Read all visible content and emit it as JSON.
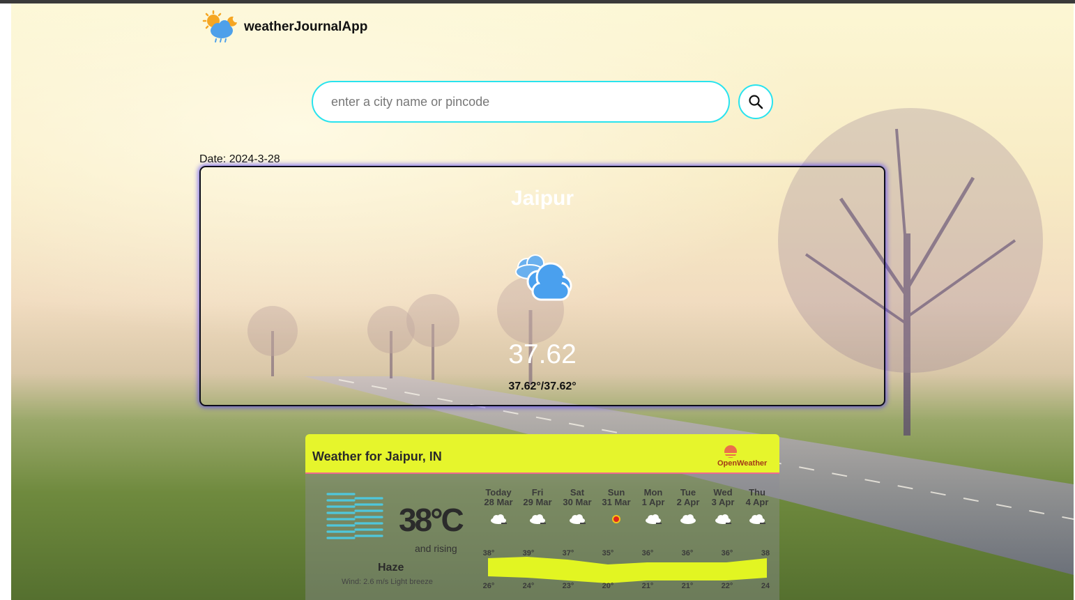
{
  "app": {
    "title": "weatherJournalApp"
  },
  "search": {
    "placeholder": "enter a city name or pincode"
  },
  "date_line": "Date: 2024-3-28",
  "card": {
    "city": "Jaipur",
    "temp": "37.62",
    "range": "37.62°/37.62°",
    "icon": "cloud-icon"
  },
  "widget": {
    "title": "Weather for Jaipur, IN",
    "brand": "OpenWeather",
    "current": {
      "temp": "38°C",
      "trend": "and rising",
      "condition": "Haze",
      "wind": "Wind: 2.6 m/s Light breeze",
      "icon": "haze-icon"
    },
    "forecast": [
      {
        "day": "Today",
        "date": "28 Mar",
        "hi": "38°",
        "lo": "26°",
        "icon": "cloud-icon"
      },
      {
        "day": "Fri",
        "date": "29 Mar",
        "hi": "39°",
        "lo": "24°",
        "icon": "cloud-icon"
      },
      {
        "day": "Sat",
        "date": "30 Mar",
        "hi": "37°",
        "lo": "23°",
        "icon": "cloud-icon"
      },
      {
        "day": "Sun",
        "date": "31 Mar",
        "hi": "35°",
        "lo": "20°",
        "icon": "sun-icon"
      },
      {
        "day": "Mon",
        "date": "1 Apr",
        "hi": "36°",
        "lo": "21°",
        "icon": "cloud-icon"
      },
      {
        "day": "Tue",
        "date": "2 Apr",
        "hi": "36°",
        "lo": "21°",
        "icon": "cloud-icon"
      },
      {
        "day": "Wed",
        "date": "3 Apr",
        "hi": "36°",
        "lo": "22°",
        "icon": "cloud-icon"
      },
      {
        "day": "Thu",
        "date": "4 Apr",
        "hi": "38",
        "lo": "24",
        "icon": "cloud-icon"
      }
    ]
  },
  "colors": {
    "accent": "#29e3ee",
    "widget_header": "#e6f52c",
    "band": "#e2f522",
    "card_glow": "#4632ff"
  }
}
